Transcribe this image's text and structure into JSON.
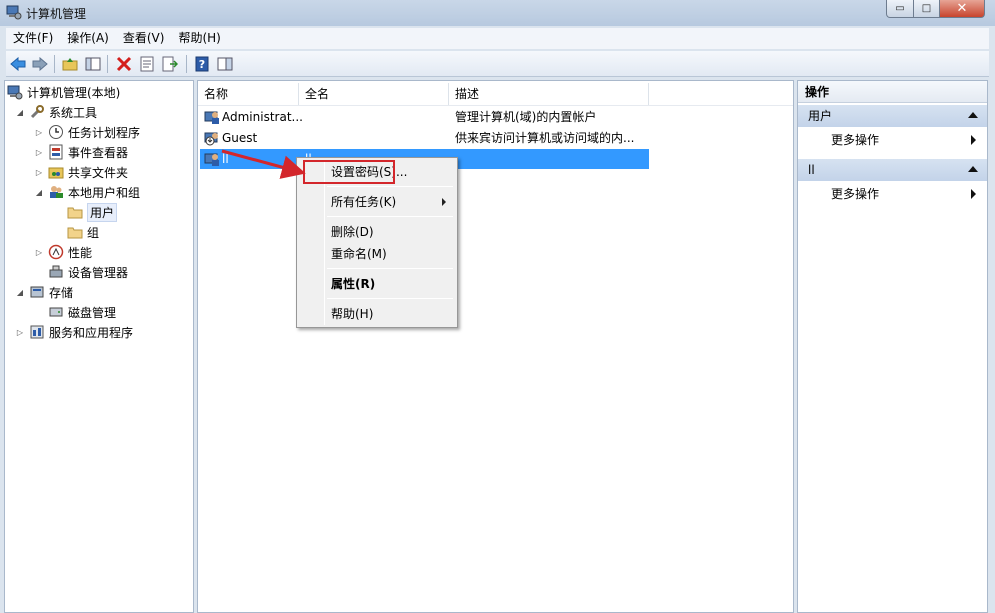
{
  "window": {
    "title": "计算机管理",
    "controls": {
      "minimize": "▭",
      "maximize": "□",
      "close": "✕"
    }
  },
  "menu": [
    "文件(F)",
    "操作(A)",
    "查看(V)",
    "帮助(H)"
  ],
  "tree": {
    "items": [
      {
        "label": "计算机管理(本地)",
        "icon": "computer-management-icon"
      },
      {
        "label": "系统工具",
        "icon": "tools-icon"
      },
      {
        "label": "任务计划程序",
        "icon": "clock-icon"
      },
      {
        "label": "事件查看器",
        "icon": "event-viewer-icon"
      },
      {
        "label": "共享文件夹",
        "icon": "shared-folder-icon"
      },
      {
        "label": "本地用户和组",
        "icon": "users-icon"
      },
      {
        "label": "用户",
        "icon": "folder-icon"
      },
      {
        "label": "组",
        "icon": "folder-icon"
      },
      {
        "label": "性能",
        "icon": "performance-icon"
      },
      {
        "label": "设备管理器",
        "icon": "device-manager-icon"
      },
      {
        "label": "存储",
        "icon": "storage-icon"
      },
      {
        "label": "磁盘管理",
        "icon": "disk-icon"
      },
      {
        "label": "服务和应用程序",
        "icon": "services-icon"
      }
    ]
  },
  "list": {
    "columns": [
      "名称",
      "全名",
      "描述"
    ],
    "rows": [
      {
        "name": "Administrat...",
        "fullname": "",
        "description": "管理计算机(域)的内置帐户"
      },
      {
        "name": "Guest",
        "fullname": "",
        "description": "供来宾访问计算机或访问域的内..."
      },
      {
        "name": "ll",
        "fullname": "ll",
        "description": ""
      }
    ]
  },
  "actions": {
    "title": "操作",
    "sections": [
      {
        "label": "用户",
        "item": "更多操作"
      },
      {
        "label": "ll",
        "item": "更多操作"
      }
    ]
  },
  "context_menu": {
    "set_password": "设置密码(S)...",
    "all_tasks": "所有任务(K)",
    "delete": "删除(D)",
    "rename": "重命名(M)",
    "properties": "属性(R)",
    "help": "帮助(H)"
  },
  "colors": {
    "selection": "#3399ff",
    "annotation_red": "#d3262b"
  }
}
